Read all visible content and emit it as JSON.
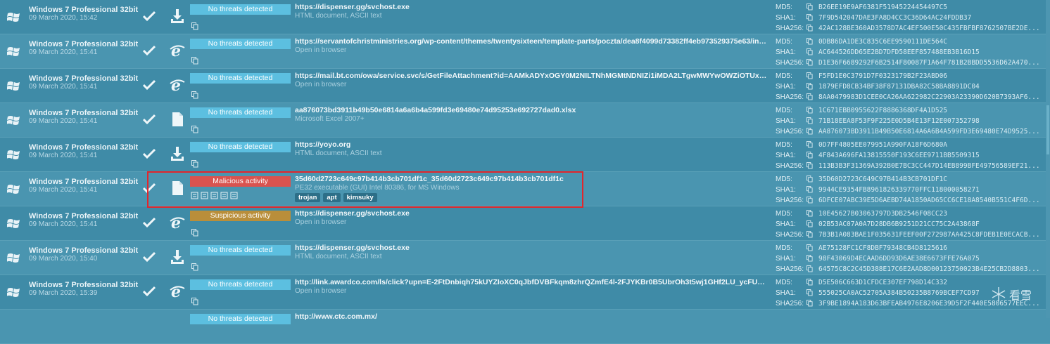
{
  "rows": [
    {
      "os": "Windows 7 Professional 32bit",
      "date": "09 March 2020, 15:42",
      "type": "download",
      "verdict": "No threats detected",
      "verdict_class": "clean",
      "name": "https://dispenser.gg/svchost.exe",
      "desc": "HTML document, ASCII text",
      "md5": "B26EE19E9AF6381F51945224454497C5",
      "sha1": "7F9D542047DAE3FA8D4CC3C36D64AC24FDDB37",
      "sha256": "42AC128BE360AD3578D7AC4EF500E50C435FBFBF8762507BE2DE..."
    },
    {
      "os": "Windows 7 Professional 32bit",
      "date": "09 March 2020, 15:41",
      "type": "browser",
      "verdict": "No threats detected",
      "verdict_class": "clean",
      "name": "https://servantofchristministries.org/wp-content/themes/twentysixteen/template-parts/poczta/dea8f4099d73382ff4eb973529375e63/index.php?x...",
      "desc": "Open in browser",
      "md5": "0DB86DA1DE3C835C6EE9590111DE564C",
      "sha1": "AC644526DD65E2BD7DFD58EEF857488EB3B16D15",
      "sha256": "D1E36F6689292F6B2514F80087F1A64F781B2BBDD5536D62A470..."
    },
    {
      "os": "Windows 7 Professional 32bit",
      "date": "09 March 2020, 15:41",
      "type": "browser",
      "verdict": "No threats detected",
      "verdict_class": "clean",
      "name": "https://mail.bt.com/owa/service.svc/s/GetFileAttachment?id=AAMkADYxOGY0M2NILTNhMGMtNDNIZi1iMDA2LTgwMWYwOWZiOTUxYwBGAAAAA...",
      "desc": "Open in browser",
      "md5": "F5FD1E0C3791D7F0323179B2F23ABD06",
      "sha1": "1879EFD8CB34BF38F87131DBA82C58BA8891DC04",
      "sha256": "8AA0479983D1CEE0CA26AA622982C22903A23390D620B7393AF6..."
    },
    {
      "os": "Windows 7 Professional 32bit",
      "date": "09 March 2020, 15:41",
      "type": "file",
      "verdict": "No threats detected",
      "verdict_class": "clean",
      "name": "aa876073bd3911b49b50e6814a6a6b4a599fd3e69480e74d95253e692727dad0.xlsx",
      "desc": "Microsoft Excel 2007+",
      "md5": "1C671EBB0955622F8886368DF4A1D525",
      "sha1": "71B18EEA8F53F9F225E0D5B4E13F12E007352798",
      "sha256": "AA876073BD3911B49B50E6814A6A6B4A599FD3E69480E74D9525..."
    },
    {
      "os": "Windows 7 Professional 32bit",
      "date": "09 March 2020, 15:41",
      "type": "download",
      "verdict": "No threats detected",
      "verdict_class": "clean",
      "name": "https://yoyo.org",
      "desc": "HTML document, ASCII text",
      "md5": "0D7FF4805EE079951A990FA18F6D680A",
      "sha1": "4F843A696FA13815550F193C6EE9711BB5509315",
      "sha256": "113B3B3F31369A392B0E7BC3CC447D14EB899BFE49756589EF21..."
    },
    {
      "os": "Windows 7 Professional 32bit",
      "date": "09 March 2020, 15:41",
      "type": "file",
      "verdict": "Malicious activity",
      "verdict_class": "mal",
      "name": "35d60d2723c649c97b414b3cb701df1c_35d60d2723c649c97b414b3cb701df1c",
      "desc": "PE32 executable (GUI) Intel 80386, for MS Windows",
      "tags": [
        "trojan",
        "apt",
        "kimsuky"
      ],
      "md5": "35D60D2723C649C97B414B3CB701DF1C",
      "sha1": "9944CE9354FB8961826339770FFC118000058271",
      "sha256": "6DFCE07ABC39E5D6AEBD74A1850AD65CC6CE18A8540B551C4F6D..."
    },
    {
      "os": "Windows 7 Professional 32bit",
      "date": "09 March 2020, 15:41",
      "type": "browser",
      "verdict": "Suspicious activity",
      "verdict_class": "sus",
      "name": "https://dispenser.gg/svchost.exe",
      "desc": "Open in browser",
      "md5": "10E45627B03063797D3DB2546F08CC23",
      "sha1": "02B53AC07A0A7D28DB6B9251D21CC75C2A43868F",
      "sha256": "7B3B1A083BAE1F035631FEEF00F272987AA425C8FDEB1E0ECACB..."
    },
    {
      "os": "Windows 7 Professional 32bit",
      "date": "09 March 2020, 15:40",
      "type": "download",
      "verdict": "No threats detected",
      "verdict_class": "clean",
      "name": "https://dispenser.gg/svchost.exe",
      "desc": "HTML document, ASCII text",
      "md5": "AE75128FC1CF8DBF79348CB4D8125616",
      "sha1": "98F43069D4ECAAD6DD93D6AE38E6673FFE76A075",
      "sha256": "64575C8C2C45D388E17C6E2AAD8D00123750023B4E25CB2D8803..."
    },
    {
      "os": "Windows 7 Professional 32bit",
      "date": "09 March 2020, 15:39",
      "type": "browser",
      "verdict": "No threats detected",
      "verdict_class": "clean",
      "name": "http://link.awardco.com/ls/click?upn=E-2FtDnbiqh75kUYZIoXC0qJbfDVBFkqm8zhrQZmfE4l-2FJYKBr0B5UbrOh3t5wj1GHf2LU_ycFUGOmj-2BzZRMC...",
      "desc": "Open in browser",
      "md5": "D5E506C663D1CFDCE307EF798D14C332",
      "sha1": "555025CA0AC52705A384B50235B8769BCEF7CD97",
      "sha256": "3F9BE1894A183D63BFEAB4976E8206E39D5F2F440E5806577EEC..."
    },
    {
      "os": "",
      "date": "",
      "type": "none",
      "verdict": "No threats detected",
      "verdict_class": "clean",
      "name": "http://www.ctc.com.mx/",
      "desc": "",
      "md5": "",
      "sha1": "",
      "sha256": ""
    }
  ],
  "labels": {
    "md5": "MD5:",
    "sha1": "SHA1:",
    "sha256": "SHA256:"
  },
  "watermark": "看雪"
}
